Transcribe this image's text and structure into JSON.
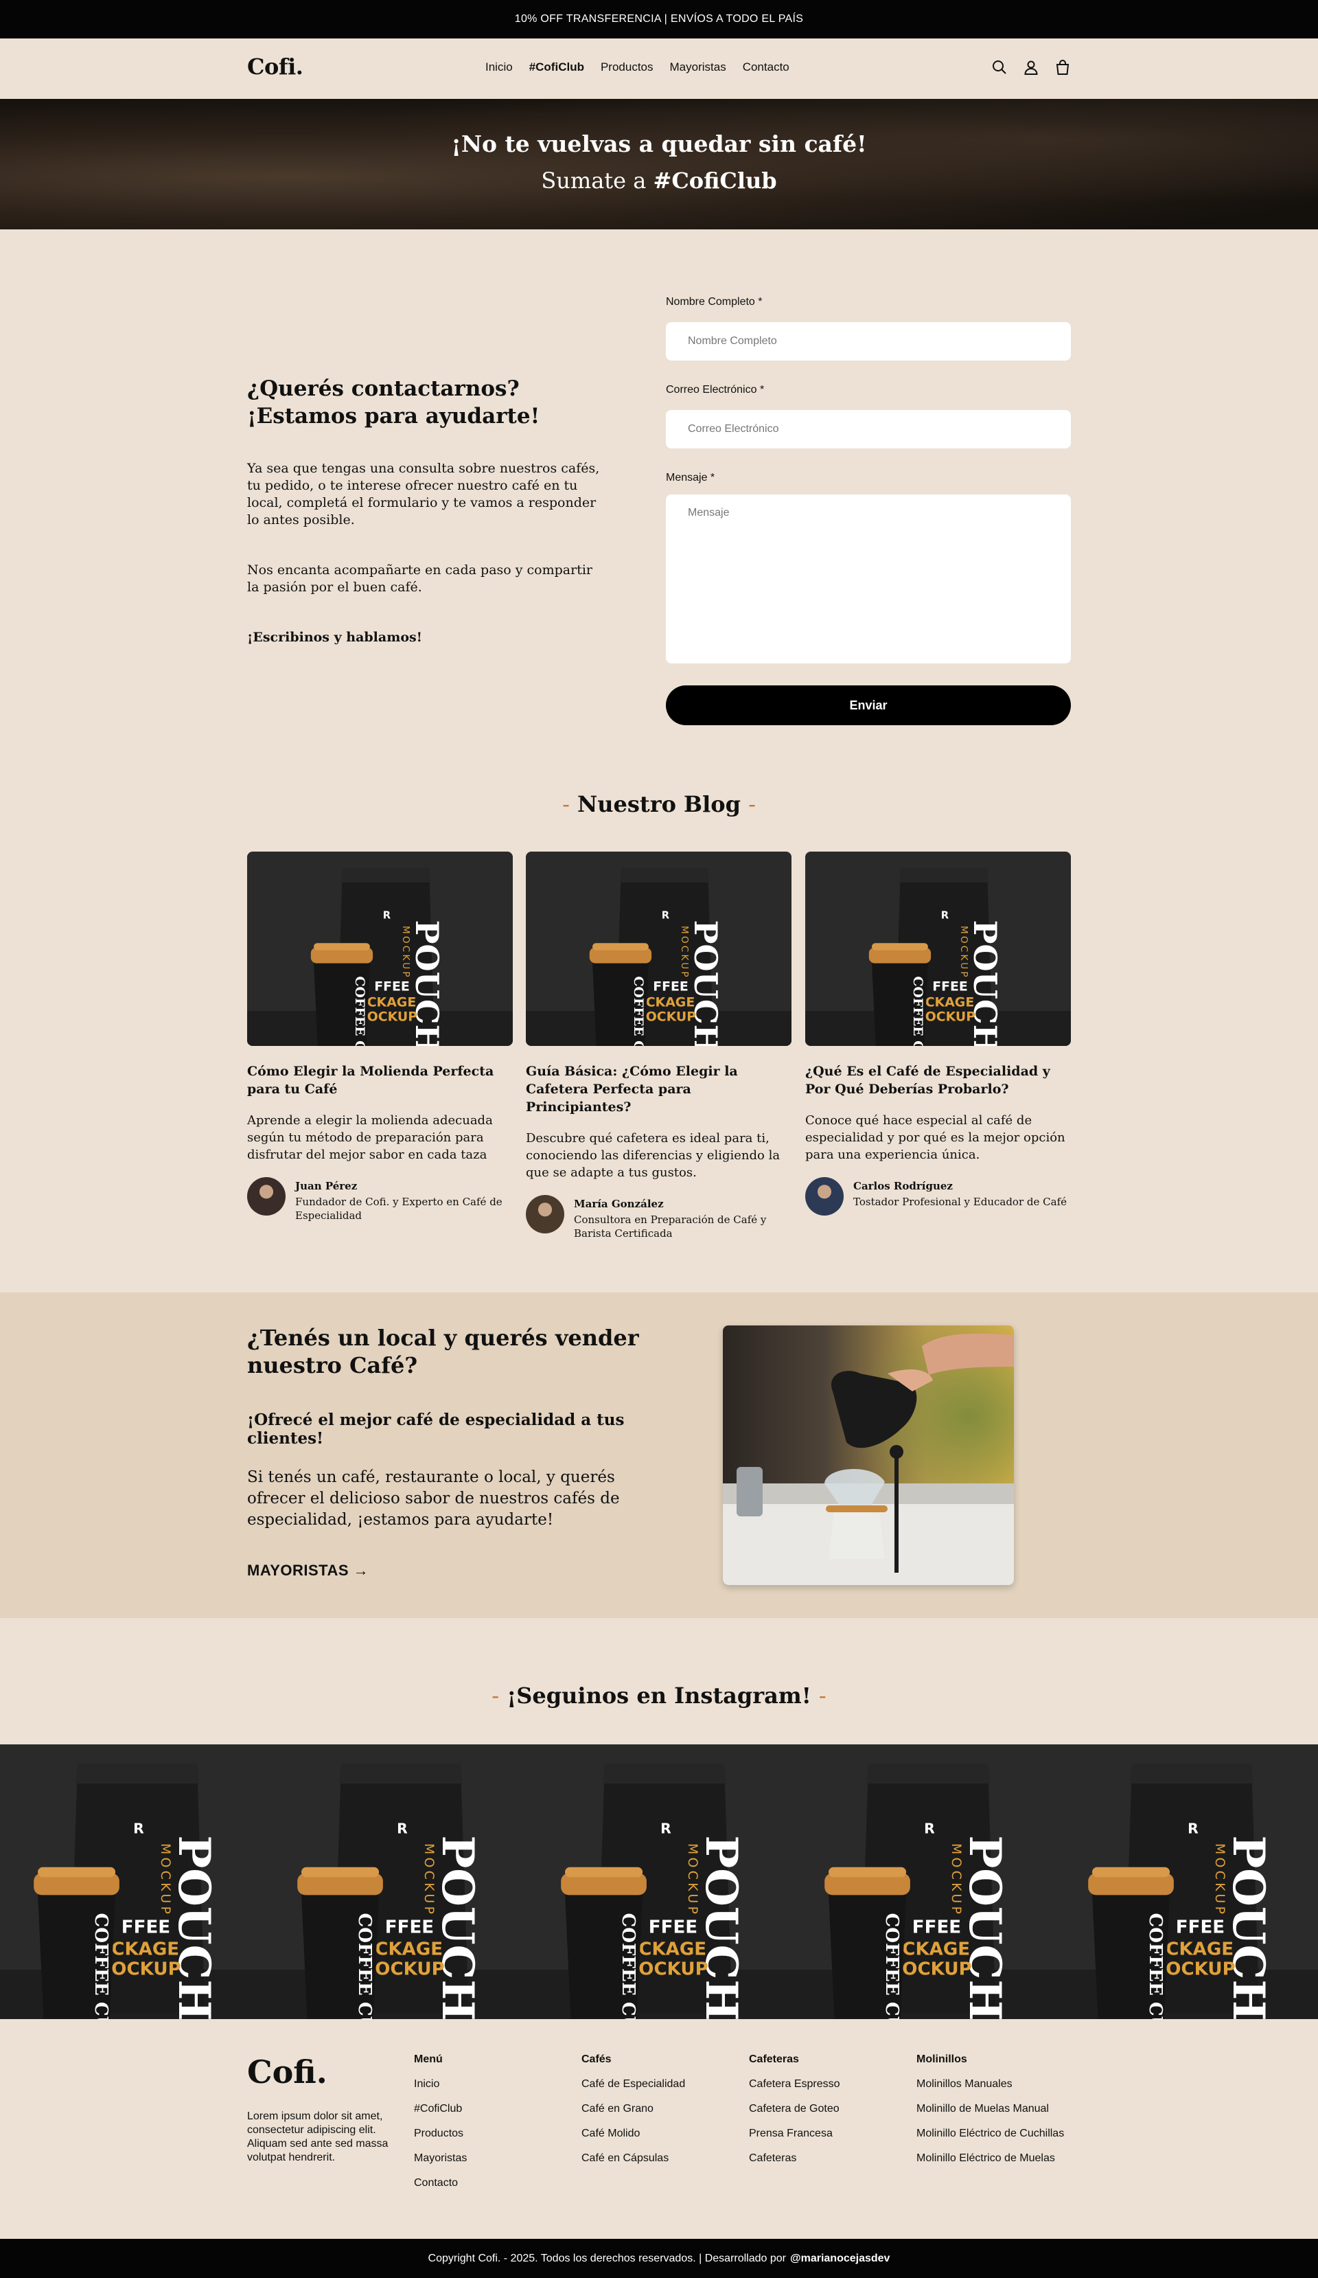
{
  "announcement": "10% OFF TRANSFERENCIA | ENVÍOS A TODO EL PAÍS",
  "header": {
    "logo": "Cofi.",
    "nav": [
      "Inicio",
      "#CofiClub",
      "Productos",
      "Mayoristas",
      "Contacto"
    ],
    "icons": [
      "search-icon",
      "user-icon",
      "bag-icon"
    ]
  },
  "hero": {
    "title": "¡No te vuelvas a quedar sin café!",
    "subtitle_prefix": "Sumate a ",
    "subtitle_brand": "#CofiClub"
  },
  "contact": {
    "heading": "¿Querés contactarnos? ¡Estamos para ayudarte!",
    "p1": "Ya sea que tengas una consulta sobre nuestros cafés, tu pedido, o te interese ofrecer nuestro café en tu local, completá el formulario y te vamos a responder lo antes posible.",
    "p2": "Nos encanta acompañarte en cada paso y compartir la pasión por el buen café.",
    "p3": "¡Escribinos y hablamos!",
    "form": {
      "name_label": "Nombre Completo *",
      "name_placeholder": "Nombre Completo",
      "email_label": "Correo Electrónico *",
      "email_placeholder": "Correo Electrónico",
      "message_label": "Mensaje *",
      "message_placeholder": "Mensaje",
      "submit": "Enviar"
    }
  },
  "blog": {
    "title": "Nuestro Blog",
    "posts": [
      {
        "title": "Cómo Elegir la Molienda Perfecta para tu Café",
        "excerpt": "Aprende a elegir la molienda adecuada según tu método de preparación para disfrutar del mejor sabor en cada taza",
        "author": "Juan Pérez",
        "role": "Fundador de Cofi. y Experto en Café de Especialidad"
      },
      {
        "title": "Guía Básica: ¿Cómo Elegir la Cafetera Perfecta para Principiantes?",
        "excerpt": "Descubre qué cafetera es ideal para ti, conociendo las diferencias y eligiendo la que se adapte a tus gustos.",
        "author": "María González",
        "role": "Consultora en Preparación de Café y Barista Certificada"
      },
      {
        "title": "¿Qué Es el Café de Especialidad y Por Qué Deberías Probarlo?",
        "excerpt": "Conoce qué hace especial al café de especialidad y por qué es la mejor opción para una experiencia única.",
        "author": "Carlos Rodríguez",
        "role": "Tostador Profesional y Educador de Café"
      }
    ],
    "mockup_text": {
      "pouch": "POUCH",
      "mockup": "MOCKUP",
      "r": "R",
      "ffee": "FFEE",
      "ckage": "CKAGE",
      "ockup": "OCKUP",
      "coffee_cup": "COFFEE CUP"
    }
  },
  "wholesale": {
    "heading": "¿Tenés un local y querés vender nuestro Café?",
    "subheading": "¡Ofrecé el mejor café de especialidad a tus clientes!",
    "body": "Si tenés un café, restaurante o local, y querés ofrecer el delicioso sabor de nuestros cafés de especialidad, ¡estamos para ayudarte!",
    "link": "MAYORISTAS →"
  },
  "instagram": {
    "title": "¡Seguinos en Instagram!"
  },
  "footer": {
    "logo": "Cofi.",
    "description": "Lorem ipsum dolor sit amet, consectetur adipiscing elit. Aliquam sed ante sed massa volutpat hendrerit.",
    "columns": [
      {
        "title": "Menú",
        "items": [
          "Inicio",
          "#CofiClub",
          "Productos",
          "Mayoristas",
          "Contacto"
        ]
      },
      {
        "title": "Cafés",
        "items": [
          "Café de Especialidad",
          "Café en Grano",
          "Café Molido",
          "Café en Cápsulas"
        ]
      },
      {
        "title": "Cafeteras",
        "items": [
          "Cafetera Espresso",
          "Cafetera de Goteo",
          "Prensa Francesa",
          "Cafeteras"
        ]
      },
      {
        "title": "Molinillos",
        "items": [
          "Molinillos Manuales",
          "Molinillo de Muelas Manual",
          "Molinillo Eléctrico de Cuchillas",
          "Molinillo Eléctrico de Muelas"
        ]
      }
    ],
    "copyright": "Copyright Cofi. - 2025. Todos los derechos reservados. | Desarrollado por",
    "developer": "@marianocejasdev"
  },
  "colors": {
    "background": "#ece1d4",
    "wholesale_bg": "#e2d2be",
    "accent": "#c8773a",
    "dark": "#050505"
  }
}
